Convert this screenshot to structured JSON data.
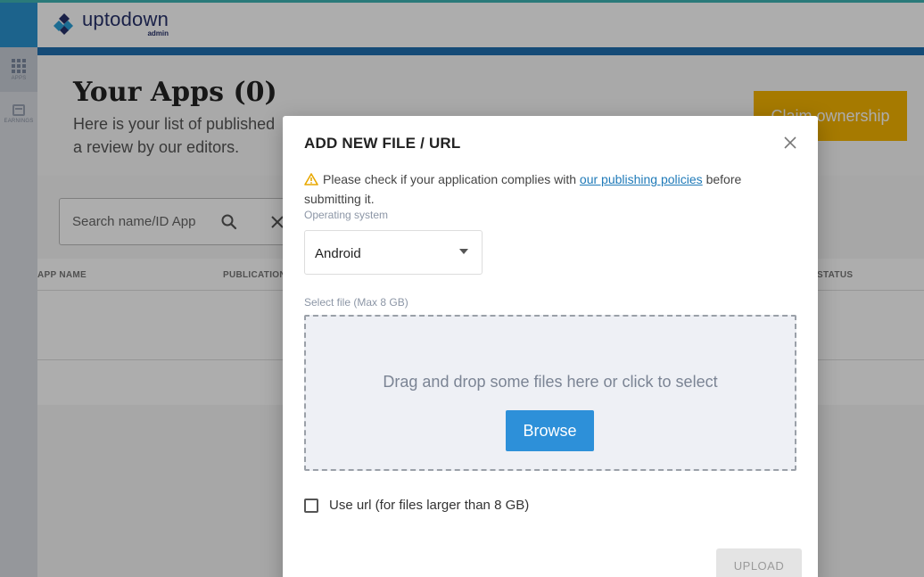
{
  "brand": {
    "name": "uptodown",
    "sub": "admin"
  },
  "sidebar": {
    "items": [
      {
        "label": "APPS"
      },
      {
        "label": "EARNINGS"
      }
    ]
  },
  "page": {
    "title": "Your Apps (0)",
    "subtitle": "Here is your list of published a review by our editors.",
    "claim_label": "Claim ownership"
  },
  "search": {
    "placeholder": "Search name/ID App"
  },
  "table": {
    "columns": [
      "APP NAME",
      "PUBLICATION",
      "STATUS"
    ]
  },
  "modal": {
    "title": "ADD NEW FILE / URL",
    "notice_before": "Please check if your application complies with ",
    "notice_link": "our publishing policies",
    "notice_after": " before submitting it.",
    "os_label": "Operating system",
    "os_value": "Android",
    "file_label": "Select file (Max 8 GB)",
    "drop_text": "Drag and drop some files here or click to select",
    "browse_label": "Browse",
    "url_checkbox_label": "Use url (for files larger than 8 GB)",
    "url_checked": false,
    "upload_label": "UPLOAD"
  },
  "colors": {
    "primary_blue": "#2d90d9",
    "claim_yellow": "#f5b400",
    "brand_navy": "#27326a",
    "link": "#1f7ab8"
  },
  "icons": [
    "logo-mark-icon",
    "apps-grid-icon",
    "calendar-icon",
    "search-icon",
    "clear-icon",
    "close-icon",
    "warning-icon",
    "chevron-down-icon"
  ]
}
